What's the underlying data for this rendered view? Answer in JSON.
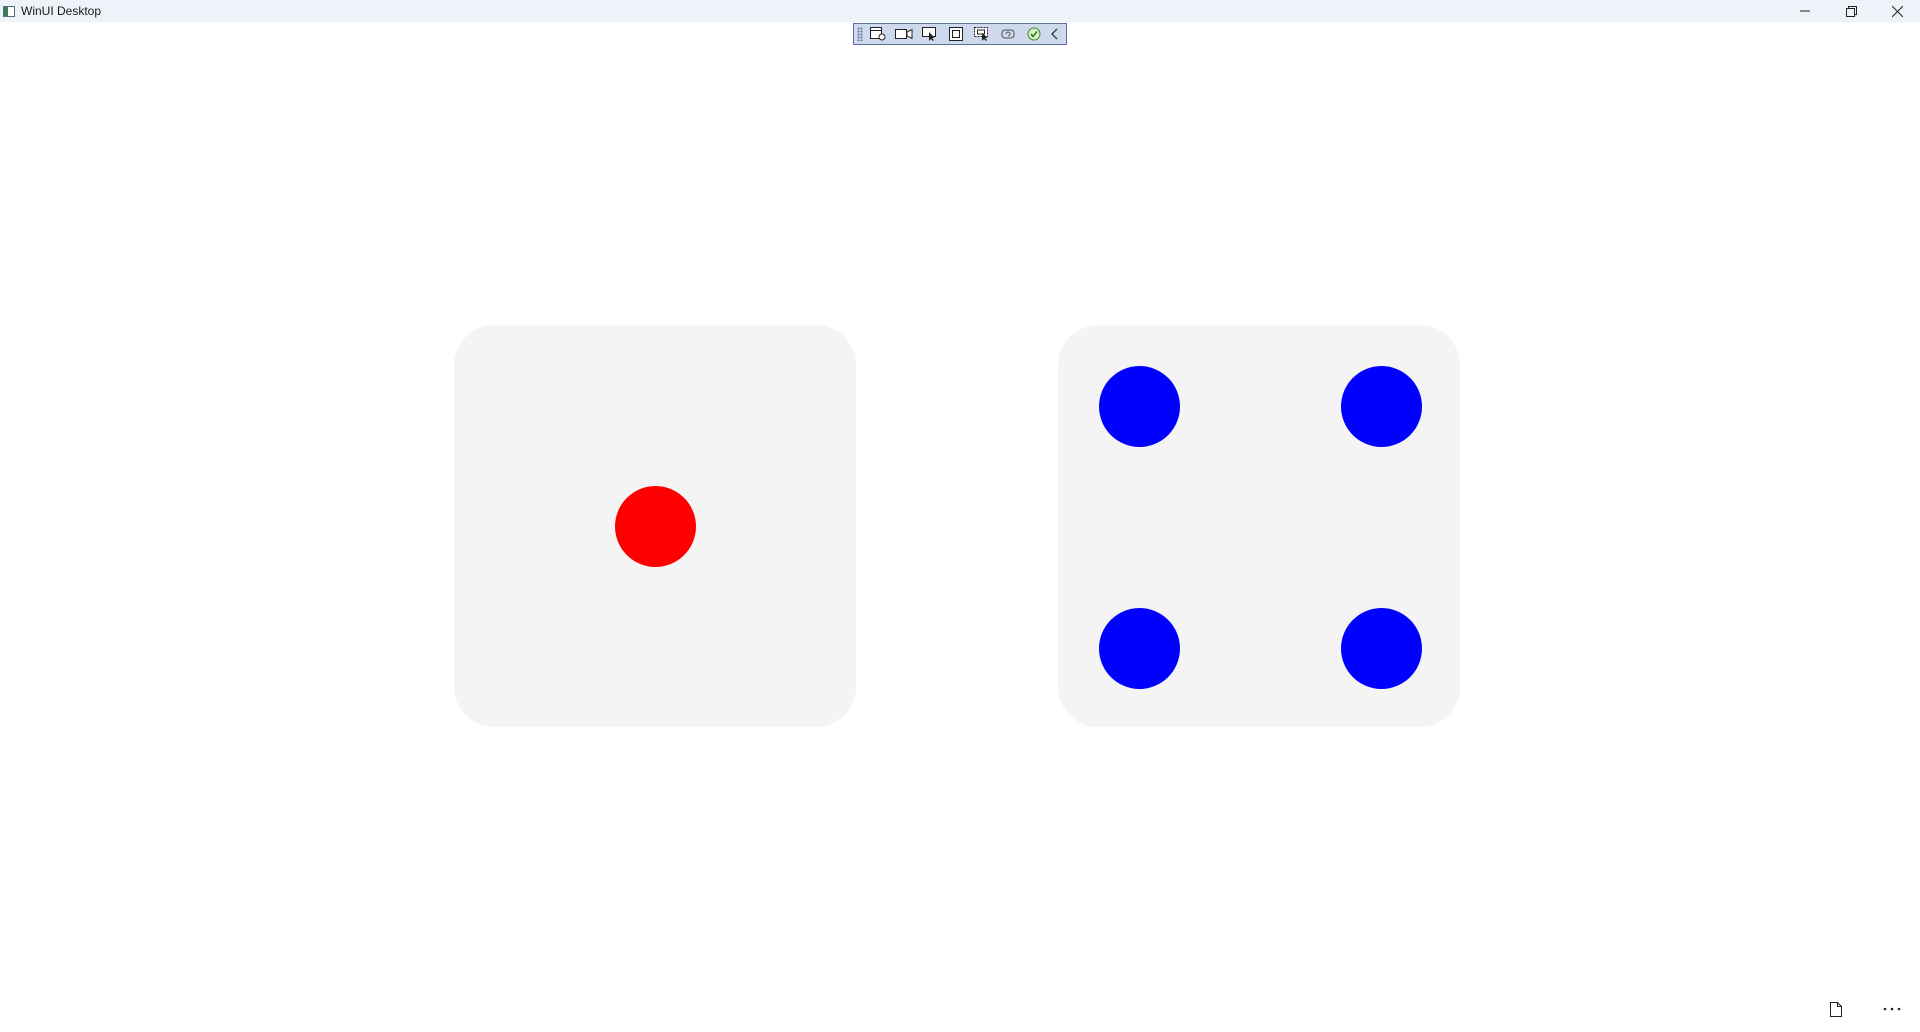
{
  "window": {
    "title": "WinUI Desktop",
    "controls": [
      "minimize-icon",
      "restore-icon",
      "close-icon"
    ]
  },
  "debug_toolbar": {
    "buttons": [
      "live-visual-tree-icon",
      "record-icon",
      "select-element-icon",
      "display-layout-adorners-icon",
      "track-focus-icon",
      "hot-reload-icon",
      "accessibility-check-icon",
      "collapse-icon"
    ]
  },
  "dice": [
    {
      "value": 1,
      "pip_color": "#ff0000"
    },
    {
      "value": 4,
      "pip_color": "#0000ff"
    }
  ],
  "colors": {
    "die_face": "#f4f4f4",
    "titlebar": "#eef3fa",
    "red_pip": "#ff0000",
    "blue_pip": "#0000ff"
  },
  "bottom_bar": {
    "buttons": [
      "document-icon",
      "more-options-icon"
    ]
  }
}
